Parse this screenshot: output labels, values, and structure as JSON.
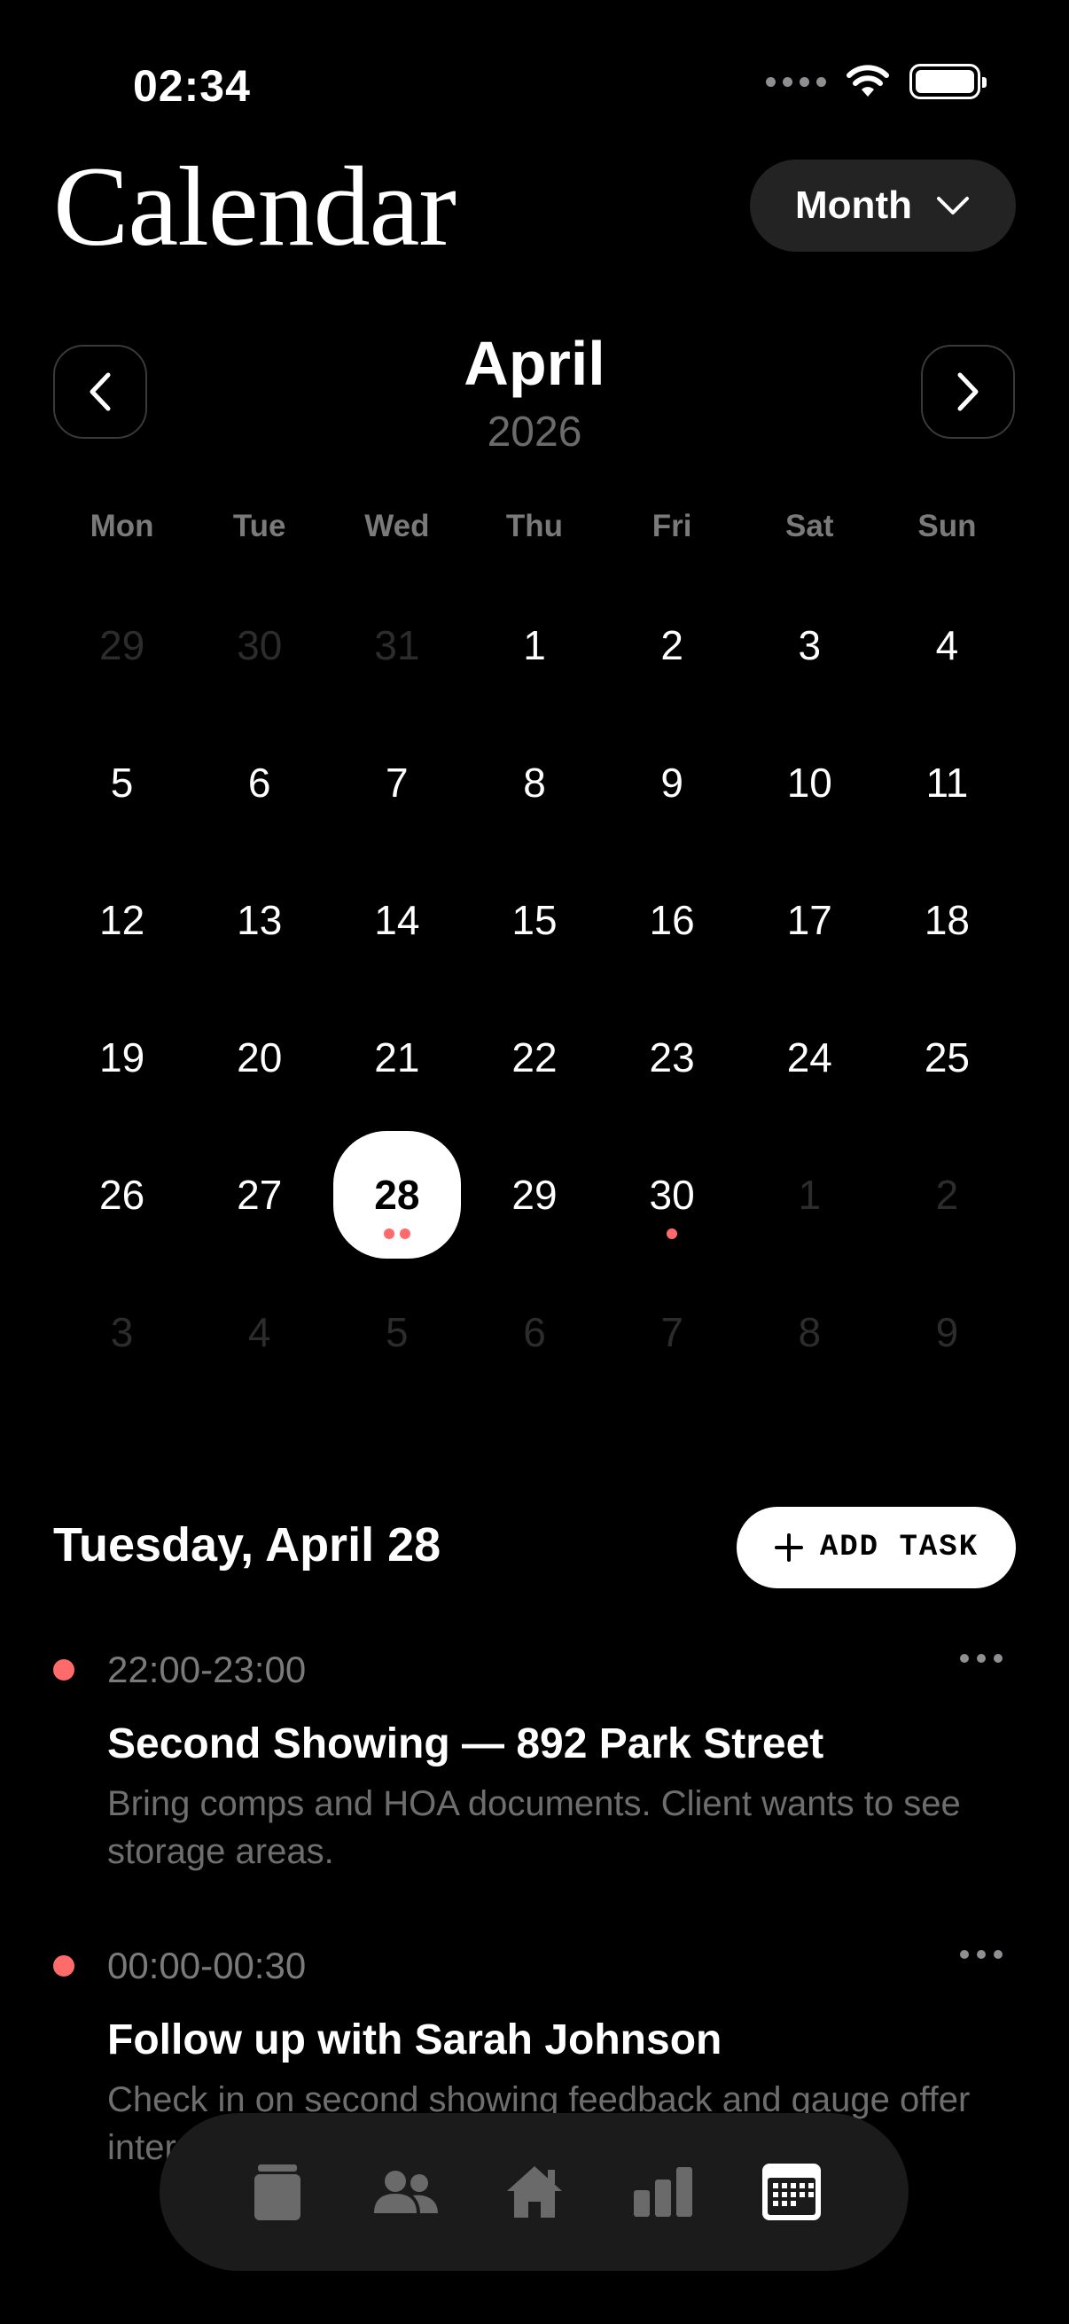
{
  "status_bar": {
    "time": "02:34"
  },
  "header": {
    "title": "Calendar",
    "view_mode": "Month"
  },
  "month_nav": {
    "month": "April",
    "year": "2026"
  },
  "weekdays": [
    "Mon",
    "Tue",
    "Wed",
    "Thu",
    "Fri",
    "Sat",
    "Sun"
  ],
  "weeks": [
    [
      {
        "d": "29",
        "m": true
      },
      {
        "d": "30",
        "m": true
      },
      {
        "d": "31",
        "m": true
      },
      {
        "d": "1"
      },
      {
        "d": "2"
      },
      {
        "d": "3"
      },
      {
        "d": "4"
      }
    ],
    [
      {
        "d": "5"
      },
      {
        "d": "6"
      },
      {
        "d": "7"
      },
      {
        "d": "8"
      },
      {
        "d": "9"
      },
      {
        "d": "10"
      },
      {
        "d": "11"
      }
    ],
    [
      {
        "d": "12"
      },
      {
        "d": "13"
      },
      {
        "d": "14"
      },
      {
        "d": "15"
      },
      {
        "d": "16"
      },
      {
        "d": "17"
      },
      {
        "d": "18"
      }
    ],
    [
      {
        "d": "19"
      },
      {
        "d": "20"
      },
      {
        "d": "21"
      },
      {
        "d": "22"
      },
      {
        "d": "23"
      },
      {
        "d": "24"
      },
      {
        "d": "25"
      }
    ],
    [
      {
        "d": "26"
      },
      {
        "d": "27"
      },
      {
        "d": "28",
        "selected": true,
        "dots": 2
      },
      {
        "d": "29"
      },
      {
        "d": "30",
        "dots": 1
      },
      {
        "d": "1",
        "m": true
      },
      {
        "d": "2",
        "m": true
      }
    ],
    [
      {
        "d": "3",
        "m": true
      },
      {
        "d": "4",
        "m": true
      },
      {
        "d": "5",
        "m": true
      },
      {
        "d": "6",
        "m": true
      },
      {
        "d": "7",
        "m": true
      },
      {
        "d": "8",
        "m": true
      },
      {
        "d": "9",
        "m": true
      }
    ]
  ],
  "agenda": {
    "date_label": "Tuesday, April 28",
    "add_task_label": "ADD TASK",
    "events": [
      {
        "time": "22:00-23:00",
        "title": "Second Showing — 892 Park Street",
        "notes": "Bring comps and HOA documents. Client wants to see storage areas."
      },
      {
        "time": "00:00-00:30",
        "title": "Follow up with Sarah Johnson",
        "notes": "Check in on second showing feedback and gauge offer interest."
      }
    ]
  },
  "tabbar": {
    "tabs": [
      {
        "icon": "jar-icon",
        "active": false
      },
      {
        "icon": "people-icon",
        "active": false
      },
      {
        "icon": "house-icon",
        "active": false
      },
      {
        "icon": "bar-chart-icon",
        "active": false
      },
      {
        "icon": "calendar-icon",
        "active": true
      }
    ]
  },
  "colors": {
    "accent": "#ff6b6b",
    "background": "#000000",
    "muted_text": "#7a7a7a"
  }
}
